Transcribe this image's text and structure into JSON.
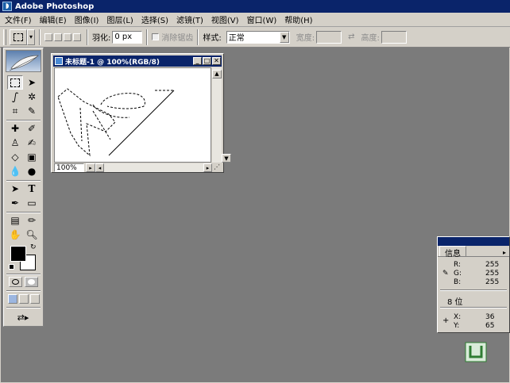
{
  "app": {
    "title": "Adobe Photoshop",
    "icon": "photoshop-app-icon"
  },
  "menu": [
    "文件(F)",
    "编辑(E)",
    "图像(I)",
    "图层(L)",
    "选择(S)",
    "滤镜(T)",
    "视图(V)",
    "窗口(W)",
    "帮助(H)"
  ],
  "options": {
    "feather_label": "羽化:",
    "feather_value": "0 px",
    "antialias_label": "消除锯齿",
    "style_label": "样式:",
    "style_value": "正常",
    "width_label": "宽度:",
    "height_label": "高度:"
  },
  "document": {
    "title": "未标题-1 @ 100%(RGB/8)",
    "zoom": "100%"
  },
  "info_panel": {
    "tab": "信息",
    "r_label": "R:",
    "r_value": "255",
    "g_label": "G:",
    "g_value": "255",
    "b_label": "B:",
    "b_value": "255",
    "bits": "8 位",
    "x_label": "X:",
    "x_value": "36",
    "y_label": "Y:",
    "y_value": "65"
  },
  "colors": {
    "foreground": "#000000",
    "background": "#ffffff",
    "titlebar": "#0a246a",
    "workspace": "#7b7b7b"
  }
}
